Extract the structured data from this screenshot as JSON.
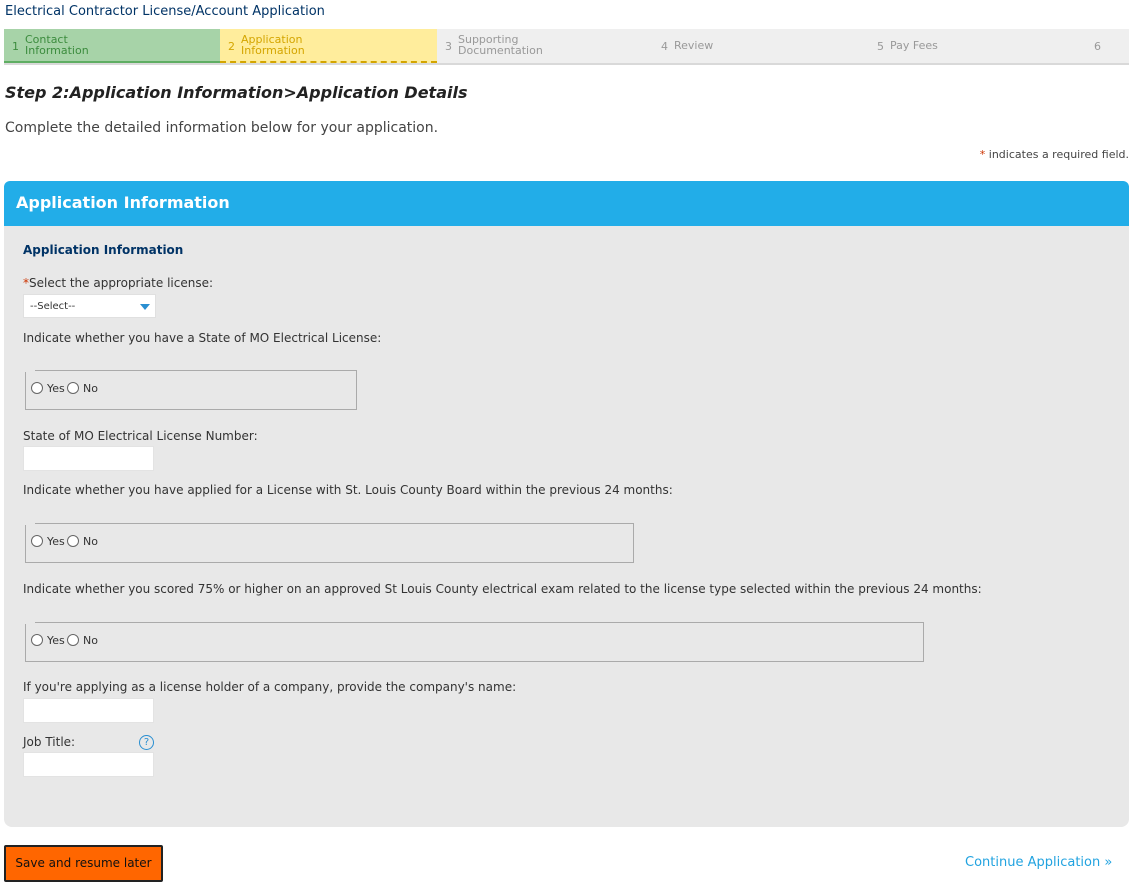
{
  "header": {
    "title": "Electrical Contractor License/Account Application"
  },
  "steps": [
    {
      "num": "1",
      "label": "Contact\nInformation"
    },
    {
      "num": "2",
      "label": "Application\nInformation"
    },
    {
      "num": "3",
      "label": "Supporting\nDocumentation"
    },
    {
      "num": "4",
      "label": "Review"
    },
    {
      "num": "5",
      "label": "Pay Fees"
    },
    {
      "num": "6",
      "label": ""
    }
  ],
  "page": {
    "step_title": "Step 2:Application Information>Application Details",
    "intro": "Complete the detailed information below for your application.",
    "required_star": "*",
    "required_note": "indicates a required field."
  },
  "panel": {
    "title": "Application Information",
    "subtitle": "Application Information",
    "license_select": {
      "label": "Select the appropriate license:",
      "value": "--Select--"
    },
    "mo_license_q": {
      "label": "Indicate whether you have a State of MO Electrical License:",
      "yes": "Yes",
      "no": "No"
    },
    "mo_license_number": {
      "label": "State of MO Electrical License Number:"
    },
    "applied_q": {
      "label": "Indicate whether you have applied for a License with St. Louis County Board within the previous 24 months:",
      "yes": "Yes",
      "no": "No"
    },
    "exam_q": {
      "label": "Indicate whether you scored 75% or higher on an approved St Louis County electrical exam related to the license type selected within the previous 24 months:",
      "yes": "Yes",
      "no": "No"
    },
    "company_name": {
      "label": "If you're applying as a license holder of a company, provide the company's name:"
    },
    "job_title": {
      "label": "Job Title:",
      "help": "?"
    }
  },
  "actions": {
    "save_label": "Save and resume later",
    "continue_label": "Continue Application »"
  }
}
